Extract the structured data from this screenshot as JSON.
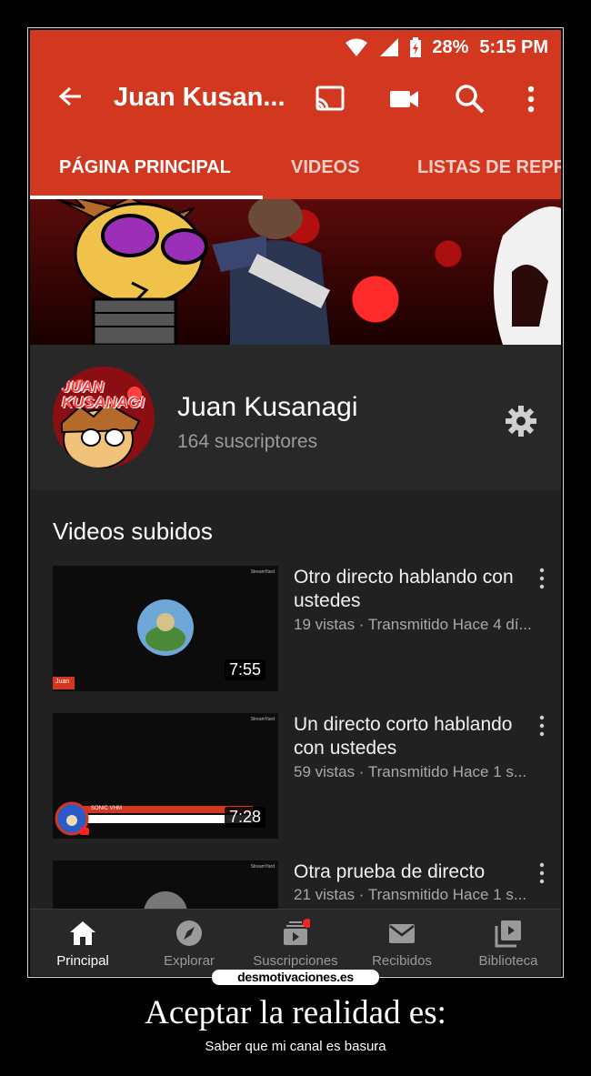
{
  "statusbar": {
    "battery": "28%",
    "time": "5:15 PM",
    "icons": [
      "wifi-icon",
      "signal-icon",
      "battery-charging-icon"
    ]
  },
  "appbar": {
    "title": "Juan Kusan...",
    "icons": [
      "back-arrow-icon",
      "cast-icon",
      "camera-icon",
      "search-icon",
      "more-vert-icon"
    ]
  },
  "tabs": [
    {
      "label": "PÁGINA PRINCIPAL",
      "active": true
    },
    {
      "label": "VIDEOS",
      "active": false
    },
    {
      "label": "LISTAS DE REPR",
      "active": false
    }
  ],
  "channel": {
    "name": "Juan Kusanagi",
    "subscribers": "164 suscriptores",
    "avatar_text": "JUAN KUSANAGI"
  },
  "uploads": {
    "heading": "Videos subidos",
    "videos": [
      {
        "title": "Otro directo hablando con ustedes",
        "meta": "19 vistas · Transmitido Hace 4 dí...",
        "duration": "7:55",
        "thumb_label": "Juan"
      },
      {
        "title": "Un directo corto hablando con ustedes",
        "meta": "59 vistas · Transmitido Hace 1 s...",
        "duration": "7:28",
        "thumb_label": "SONIC VHM"
      },
      {
        "title": "Otra prueba de directo",
        "meta": "21 vistas · Transmitido Hace 1 s...",
        "duration": ""
      }
    ],
    "thumb_brand": "StreamYard"
  },
  "bottomnav": [
    {
      "label": "Principal",
      "icon": "home-icon",
      "active": true
    },
    {
      "label": "Explorar",
      "icon": "compass-icon",
      "active": false
    },
    {
      "label": "Suscripciones",
      "icon": "subscriptions-icon",
      "active": false
    },
    {
      "label": "Recibidos",
      "icon": "mail-icon",
      "active": false
    },
    {
      "label": "Biblioteca",
      "icon": "library-icon",
      "active": false
    }
  ],
  "watermark": "desmotivaciones.es",
  "caption": {
    "title": "Aceptar la realidad es:",
    "subtitle": "Saber que mi canal es basura"
  },
  "colors": {
    "accent": "#d2371f",
    "background": "#212121",
    "notification_dot": "#ff2020"
  }
}
